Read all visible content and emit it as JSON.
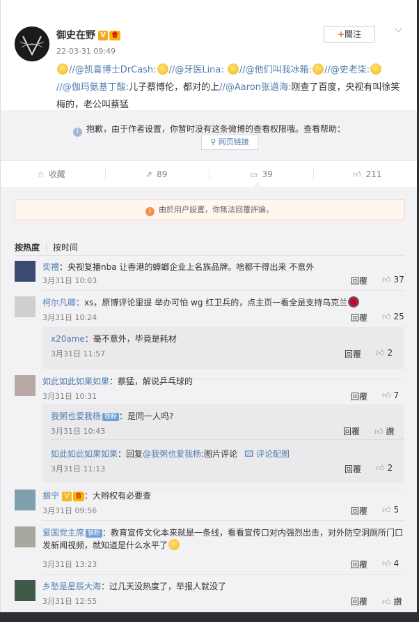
{
  "post": {
    "author": "御史在野",
    "time": "22-03-31 09:49",
    "follow_label": "關注",
    "text_parts": [
      "//@凯喜博士DrCash:",
      "//@牙医Lina:",
      "//@他们叫我冰箱:",
      "//@史老柒:",
      "//@伽玛氨基丁酸:",
      "儿子蔡博伦，都对的上",
      "//@Aaron张道海:",
      "刚查了百度，央视有叫徐笑梅的，老公叫蔡猛"
    ]
  },
  "repost": {
    "message": "抱歉，由于作者设置，你暂时没有这条微博的查看权限哦。查看帮助：",
    "link_label": "网页链接"
  },
  "actions": {
    "favorite": "收藏",
    "repost_count": "89",
    "comment_count": "39",
    "like_count": "211"
  },
  "notice": "由於用户設置，你無法回覆評論。",
  "tabs": {
    "hot": "按热度",
    "time": "按时间"
  },
  "comments": [
    {
      "user": "奕禮",
      "text": "：央视复播nba 让香港的蟑螂企业上名族品牌。啥都干得出来 不意外",
      "date": "3月31日 10:03",
      "reply": "回覆",
      "likes": "37"
    },
    {
      "user": "柯尔凡卿",
      "text": "：xs，原博评论里提 举办可怕 wg 红卫兵的，点主页一看全是支持乌克兰",
      "date": "3月31日 10:24",
      "reply": "回覆",
      "likes": "25",
      "sub": [
        {
          "user": "x20ame",
          "text": "：毫不意外，毕竟是耗材",
          "date": "3月31日 11:57",
          "reply": "回覆",
          "likes": "2"
        }
      ]
    },
    {
      "user": "如此如此如果如果",
      "text": "：蔡猛，解说乒乓球的",
      "date": "3月31日 10:31",
      "reply": "回覆",
      "likes": "7",
      "sub": [
        {
          "user": "我粥也爱我杨",
          "badge": "铁粉",
          "text": "：是同一人吗?",
          "date": "3月31日 10:43",
          "reply": "回覆",
          "likes": "讚"
        },
        {
          "user": "如此如此如果如果",
          "text_prefix": "：回复",
          "mention": "@我粥也爱我杨",
          "text": ":图片评论",
          "pic_link": "评论配图",
          "date": "3月31日 11:13",
          "reply": "回覆",
          "likes": "2"
        }
      ]
    },
    {
      "user": "掴宁",
      "text": "：大辫权有必要查",
      "date": "3月31日 09:56",
      "reply": "回覆",
      "likes": "5"
    },
    {
      "user": "爱国党主席",
      "badge": "铁粉",
      "text": "：教育宣传文化本来就是一条线，看看宣传口对内强烈出击，对外防空洞厕所门口发新闻视频，就知道是什么水平了",
      "date": "3月31日 13:23",
      "reply": "回覆",
      "likes": "4"
    },
    {
      "user": "乡愁是星辰大海",
      "text": "：过几天没热度了，举报人就没了",
      "date": "3月31日 12:55",
      "reply": "回覆",
      "likes": "讚"
    }
  ]
}
